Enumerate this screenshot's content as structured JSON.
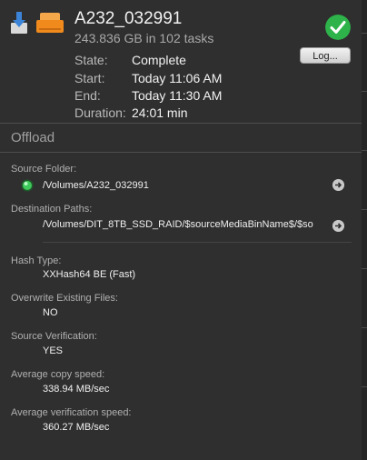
{
  "header": {
    "title": "A232_032991",
    "subtitle": "243.836 GB in 102 tasks",
    "log_button": "Log...",
    "rows": [
      {
        "label": "State:",
        "value": "Complete"
      },
      {
        "label": "Start:",
        "value": "Today 11:06 AM"
      },
      {
        "label": "End:",
        "value": "Today 11:30 AM"
      },
      {
        "label": "Duration:",
        "value": "24:01 min"
      }
    ]
  },
  "section": {
    "title": "Offload"
  },
  "details": {
    "source_folder_label": "Source Folder:",
    "source_folder_value": "/Volumes/A232_032991",
    "destination_label": "Destination Paths:",
    "destination_value": "/Volumes/DIT_8TB_SSD_RAID/$sourceMediaBinName$/$so",
    "hash_label": "Hash Type:",
    "hash_value": "XXHash64 BE (Fast)",
    "overwrite_label": "Overwrite Existing Files:",
    "overwrite_value": "NO",
    "verification_label": "Source Verification:",
    "verification_value": "YES",
    "copy_speed_label": "Average copy speed:",
    "copy_speed_value": "338.94 MB/sec",
    "verify_speed_label": "Average verification speed:",
    "verify_speed_value": "360.27 MB/sec"
  },
  "colors": {
    "status_green": "#2db34a",
    "drive_orange": "#f08a1c",
    "download_blue": "#3c84d8"
  },
  "icons": [
    "download-icon",
    "drive-icon",
    "checkmark-icon",
    "status-led-icon",
    "reveal-arrow-icon"
  ]
}
